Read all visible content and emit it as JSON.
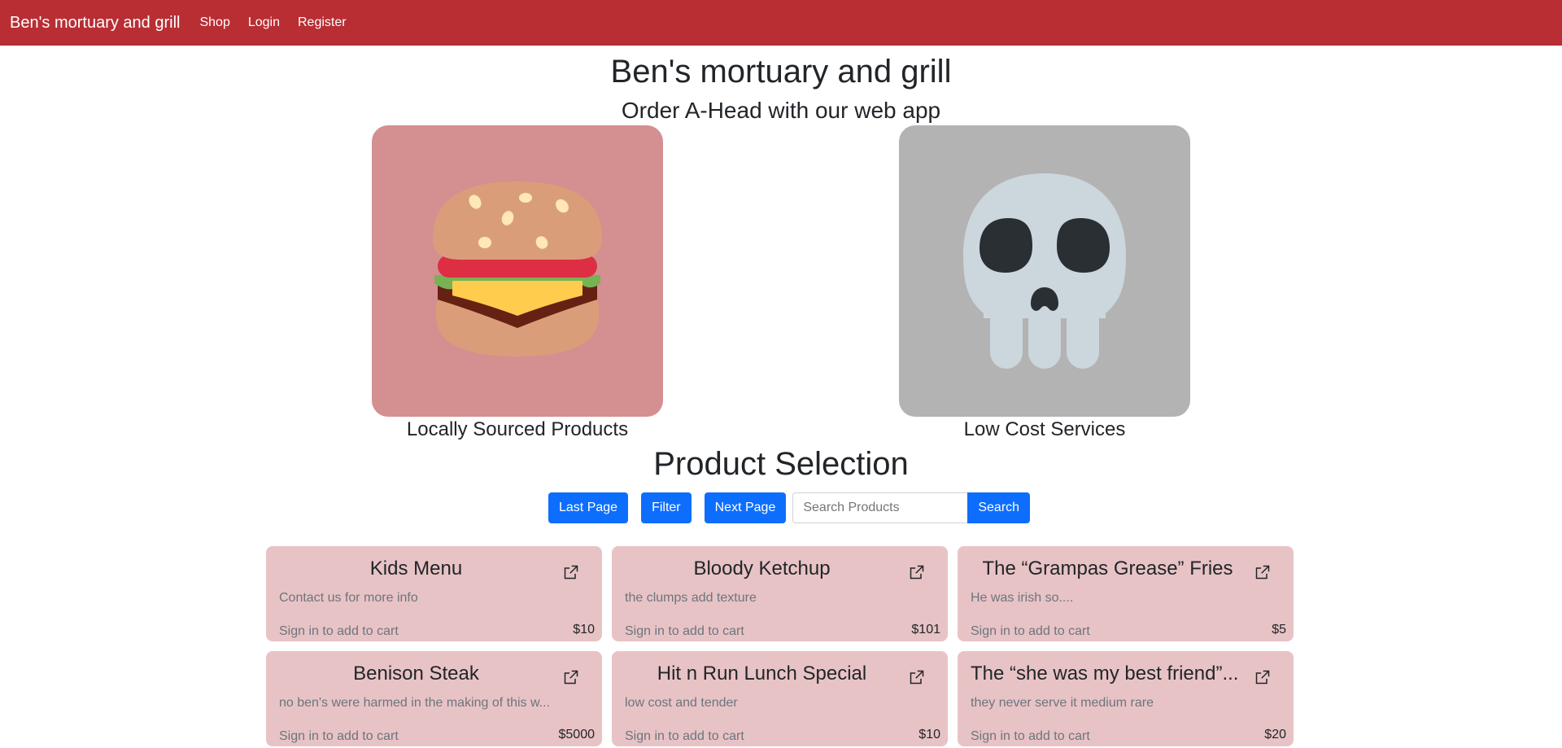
{
  "navbar": {
    "brand": "Ben's mortuary and grill",
    "links": [
      "Shop",
      "Login",
      "Register"
    ],
    "color": "#b82e33"
  },
  "hero": {
    "title": "Ben's mortuary and grill",
    "subtitle": "Order A-Head with our web app"
  },
  "features": [
    {
      "caption": "Locally Sourced Products",
      "icon": "burger-icon",
      "bg": "#d48f91"
    },
    {
      "caption": "Low Cost Services",
      "icon": "skull-icon",
      "bg": "#b3b3b3"
    }
  ],
  "products_section": {
    "title": "Product Selection",
    "last_page_label": "Last Page",
    "filter_label": "Filter",
    "next_page_label": "Next Page",
    "search_placeholder": "Search Products",
    "search_label": "Search"
  },
  "products": [
    {
      "name": "Kids Menu",
      "description": "Contact us for more info",
      "cta": "Sign in to add to cart",
      "price": "$10"
    },
    {
      "name": "Bloody Ketchup",
      "description": "the clumps add texture",
      "cta": "Sign in to add to cart",
      "price": "$101"
    },
    {
      "name": "The “Grampas Grease” Fries",
      "description": "He was irish so....",
      "cta": "Sign in to add to cart",
      "price": "$5"
    },
    {
      "name": "Benison Steak",
      "description": "no ben's were harmed in the making of this w...",
      "cta": "Sign in to add to cart",
      "price": "$5000"
    },
    {
      "name": "Hit n Run Lunch Special",
      "description": "low cost and tender",
      "cta": "Sign in to add to cart",
      "price": "$10"
    },
    {
      "name": "The “she was my best friend”...",
      "description": "they never serve it medium rare",
      "cta": "Sign in to add to cart",
      "price": "$20"
    }
  ],
  "colors": {
    "primary_button": "#0d6efd",
    "card_bg": "#e8c3c5"
  }
}
